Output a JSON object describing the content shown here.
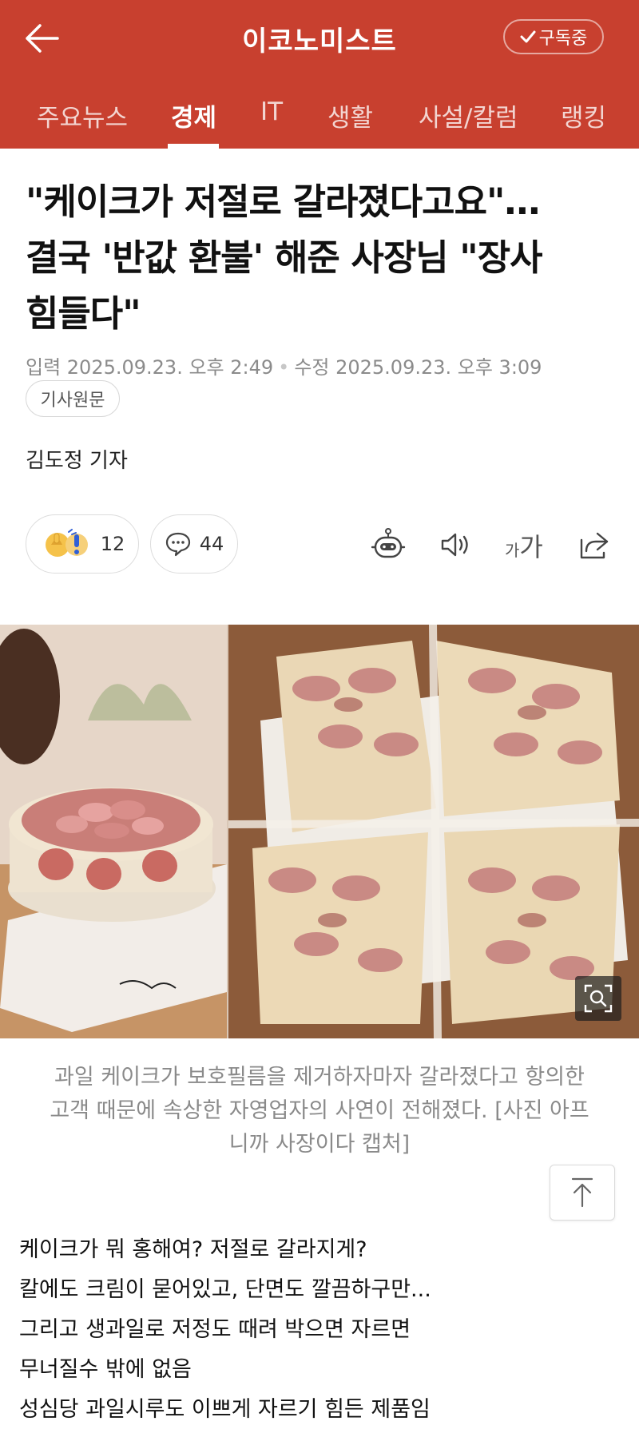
{
  "header": {
    "brand": "이코노미스트",
    "subscribe_label": "구독중"
  },
  "tabs": [
    {
      "label": "주요뉴스",
      "active": false
    },
    {
      "label": "경제",
      "active": true
    },
    {
      "label": "IT",
      "active": false
    },
    {
      "label": "생활",
      "active": false
    },
    {
      "label": "사설/칼럼",
      "active": false
    },
    {
      "label": "랭킹",
      "active": false
    }
  ],
  "article": {
    "headline_lines": [
      "\"케이크가 저절로 갈라졌다고요\"…",
      "결국 '반값 환불' 해준 사장님 \"장사",
      "힘들다\""
    ],
    "published": "입력 2025.09.23. 오후 2:49",
    "modified": "수정 2025.09.23. 오후 3:09",
    "original_label": "기사원문",
    "reporter": "김도정 기자",
    "reactions": {
      "count": "12"
    },
    "comments": {
      "count": "44"
    },
    "font_size_small": "가",
    "font_size_big": "가",
    "caption_lines": [
      "과일 케이크가 보호필름을 제거하자마자 갈라졌다고 항의한",
      "고객 때문에 속상한 자영업자의 사연이 전해졌다. [사진 아프",
      "니까 사장이다 캡처]"
    ],
    "body_lines": [
      "케이크가 뭐 홍해여? 저절로 갈라지게?",
      "칼에도 크림이 묻어있고, 단면도 깔끔하구만...",
      "그리고 생과일로 저정도 때려 박으면 자르면",
      "무너질수 밖에 없음",
      "성심당 과일시루도 이쁘게 자르기 힘든 제품임"
    ]
  },
  "colors": {
    "brand_red": "#c8402f"
  }
}
